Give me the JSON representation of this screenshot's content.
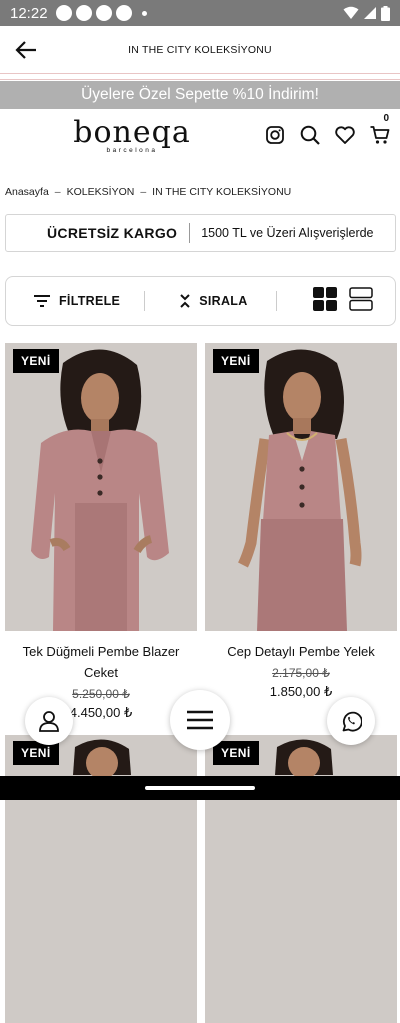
{
  "status_bar": {
    "time": "12:22"
  },
  "app_bar": {
    "title": "IN THE CITY KOLEKSİYONU",
    "back_icon": "arrow-left-icon"
  },
  "promo": {
    "text": "Üyelere Özel Sepette %10 İndirim!"
  },
  "header": {
    "logo_brand": "boneqa",
    "logo_city": "barcelona",
    "cart_count": "0",
    "icons": [
      "instagram-icon",
      "search-icon",
      "heart-icon",
      "cart-icon"
    ]
  },
  "breadcrumb": {
    "items": [
      "Anasayfa",
      "KOLEKSİYON",
      "IN THE CITY KOLEKSİYONU"
    ],
    "separator": "–"
  },
  "shipping": {
    "title": "ÜCRETSİZ KARGO",
    "description": "1500 TL ve Üzeri Alışverişlerde"
  },
  "toolbar": {
    "filter_label": "FİLTRELE",
    "sort_label": "SIRALA"
  },
  "products": [
    {
      "badge": "YENİ",
      "name": "Tek Düğmeli Pembe Blazer Ceket",
      "old_price": "5.250,00 ₺",
      "new_price": "4.450,00 ₺"
    },
    {
      "badge": "YENİ",
      "name": "Cep Detaylı Pembe Yelek",
      "old_price": "2.175,00 ₺",
      "new_price": "1.850,00 ₺"
    },
    {
      "badge": "YENİ"
    },
    {
      "badge": "YENİ"
    }
  ],
  "colors": {
    "promo_bg": "#b0b0b0",
    "status_bar": "#7a7a7a",
    "divider_pink": "#e9c5c5",
    "outfit_pink": "#b98686"
  }
}
